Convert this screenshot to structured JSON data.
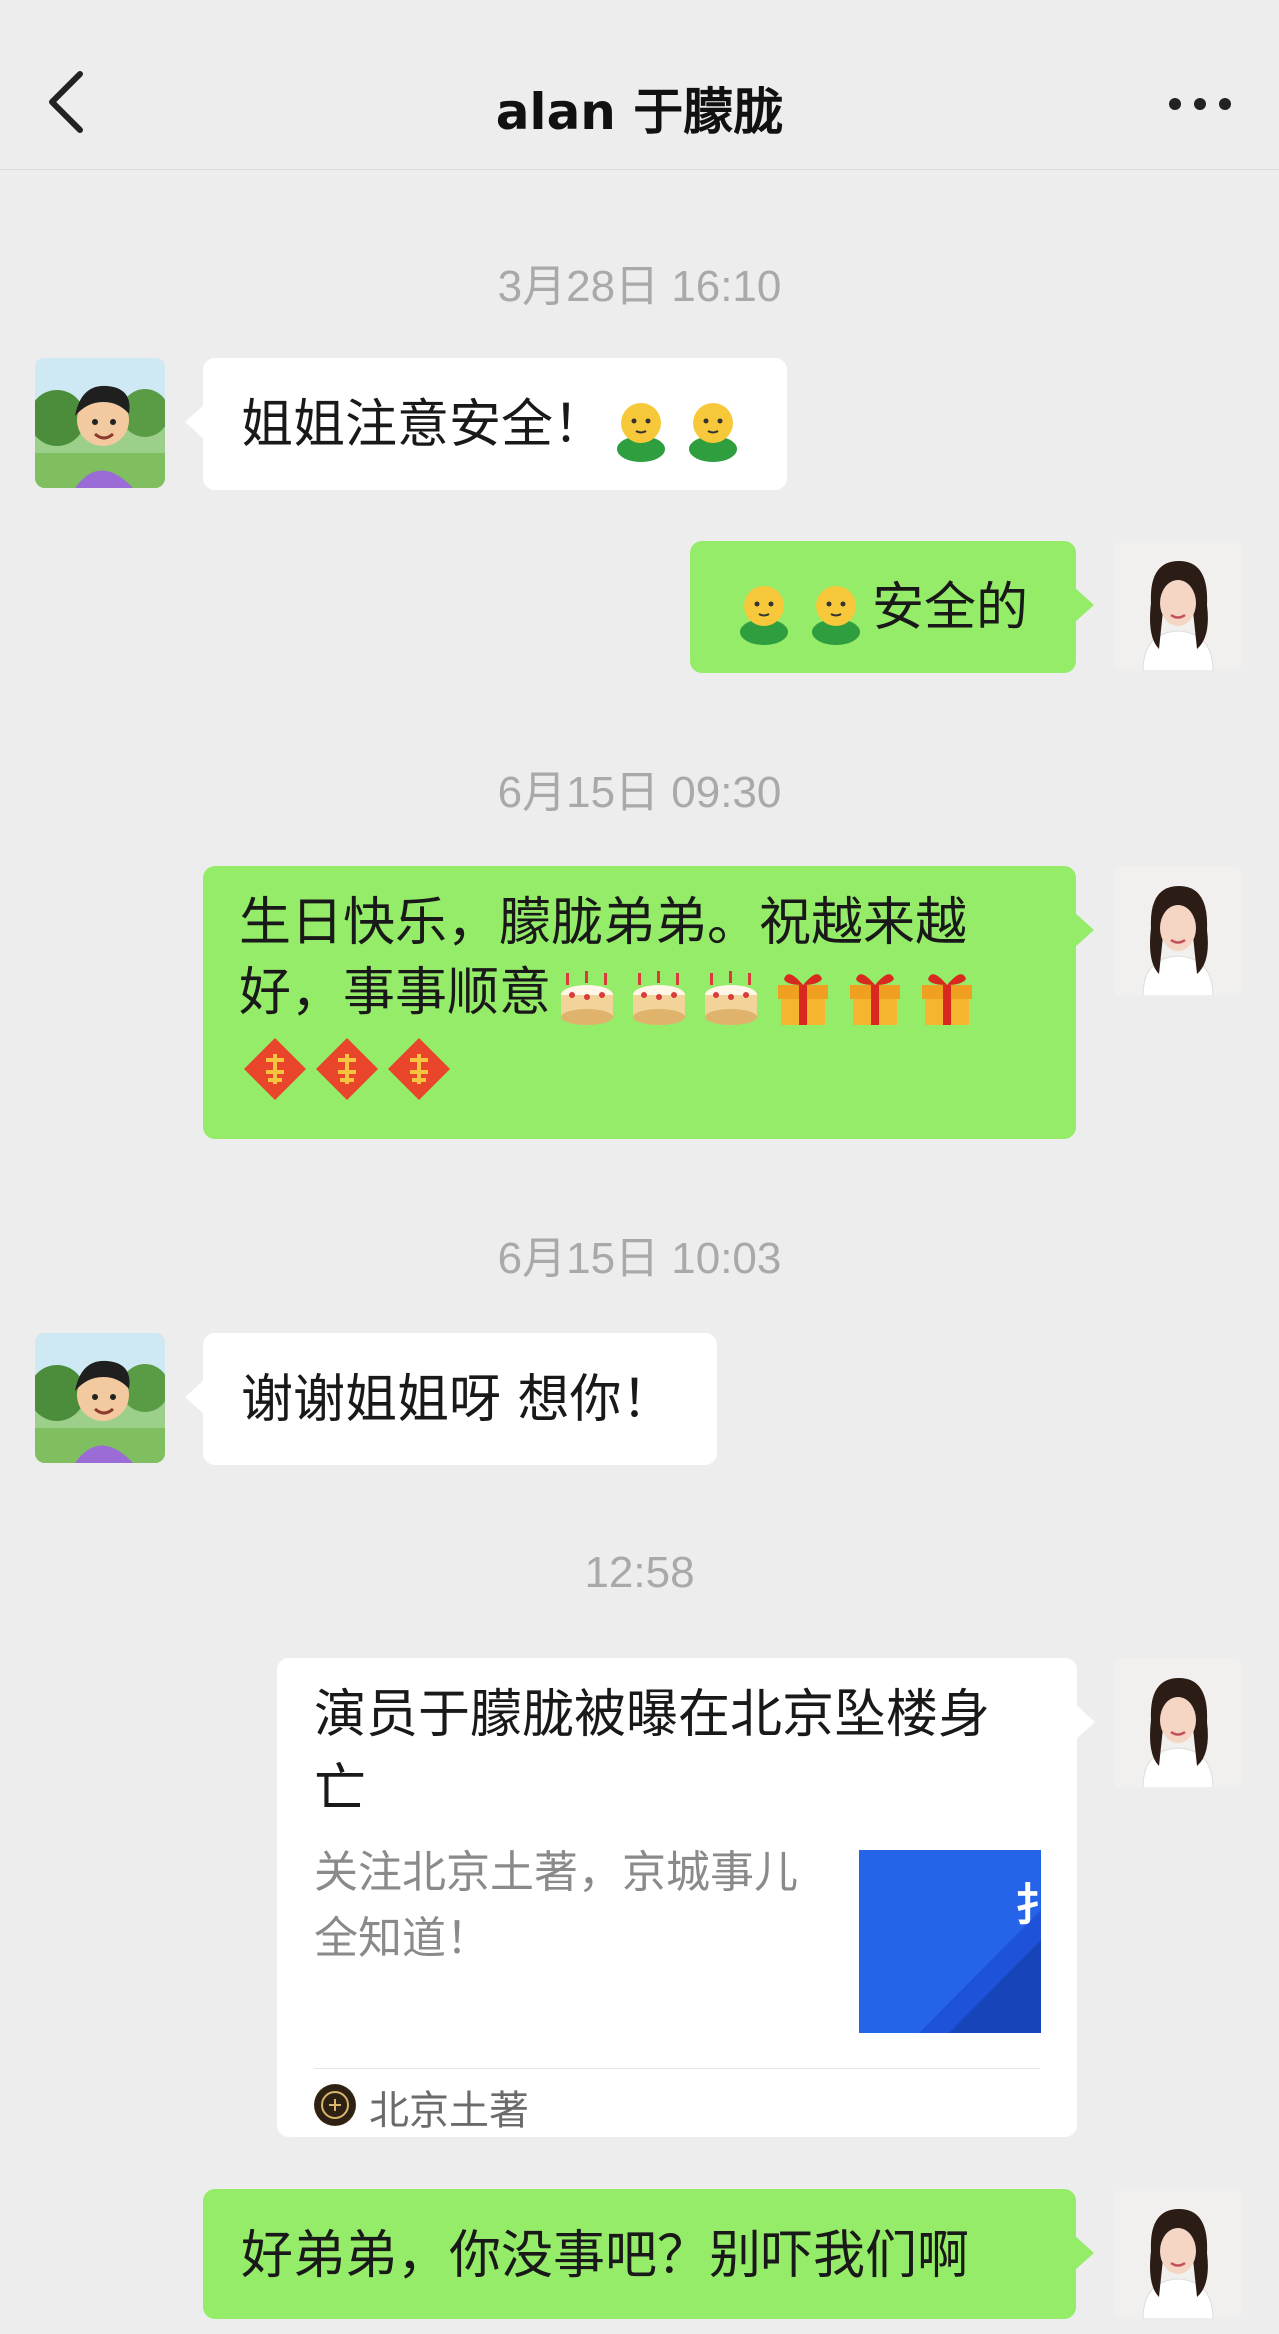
{
  "header": {
    "title": "alan 于朦胧",
    "back_icon": "chevron-left-icon",
    "more_icon": "more-dots-icon"
  },
  "timestamps": [
    "3月28日 16:10",
    "6月15日 09:30",
    "6月15日 10:03",
    "12:58"
  ],
  "messages": [
    {
      "side": "left",
      "text": "姐姐注意安全！"
    },
    {
      "side": "right",
      "text": "安全的"
    },
    {
      "side": "right",
      "text": "生日快乐，朦胧弟弟。祝越来越好，事事顺意"
    },
    {
      "side": "left",
      "text": "谢谢姐姐呀 想你！"
    },
    {
      "side": "right",
      "text": "好弟弟，你没事吧？别吓我们啊"
    }
  ],
  "card": {
    "title": "演员于朦胧被曝在北京坠楼身亡",
    "description": "关注北京土著，京城事儿全知道！",
    "source": "北京土著"
  },
  "colors": {
    "background": "#ededed",
    "sent_bubble": "#95ec69",
    "received_bubble": "#ffffff",
    "timestamp": "#a9a9a9"
  }
}
